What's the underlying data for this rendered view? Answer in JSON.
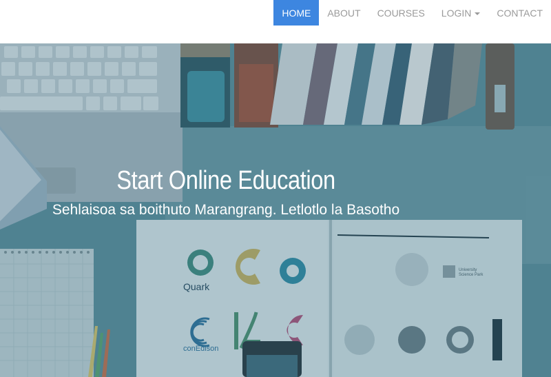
{
  "navbar": {
    "items": [
      {
        "label": "HOME",
        "active": true
      },
      {
        "label": "ABOUT",
        "active": false
      },
      {
        "label": "COURSES",
        "active": false
      },
      {
        "label": "LOGIN",
        "active": false,
        "dropdown": true
      },
      {
        "label": "CONTACT",
        "active": false
      }
    ],
    "active_color": "#3d86e0"
  },
  "hero": {
    "title": "Start Online Education",
    "subtitle": "Sehlaisoa sa boithuto Marangrang. Letlotlo la Basotho",
    "background": "desk photo with laptop, books and notebook",
    "overlay_color": "#34687e",
    "logos": [
      "Quark",
      "conEdison"
    ],
    "book_title": "University Science Park"
  }
}
